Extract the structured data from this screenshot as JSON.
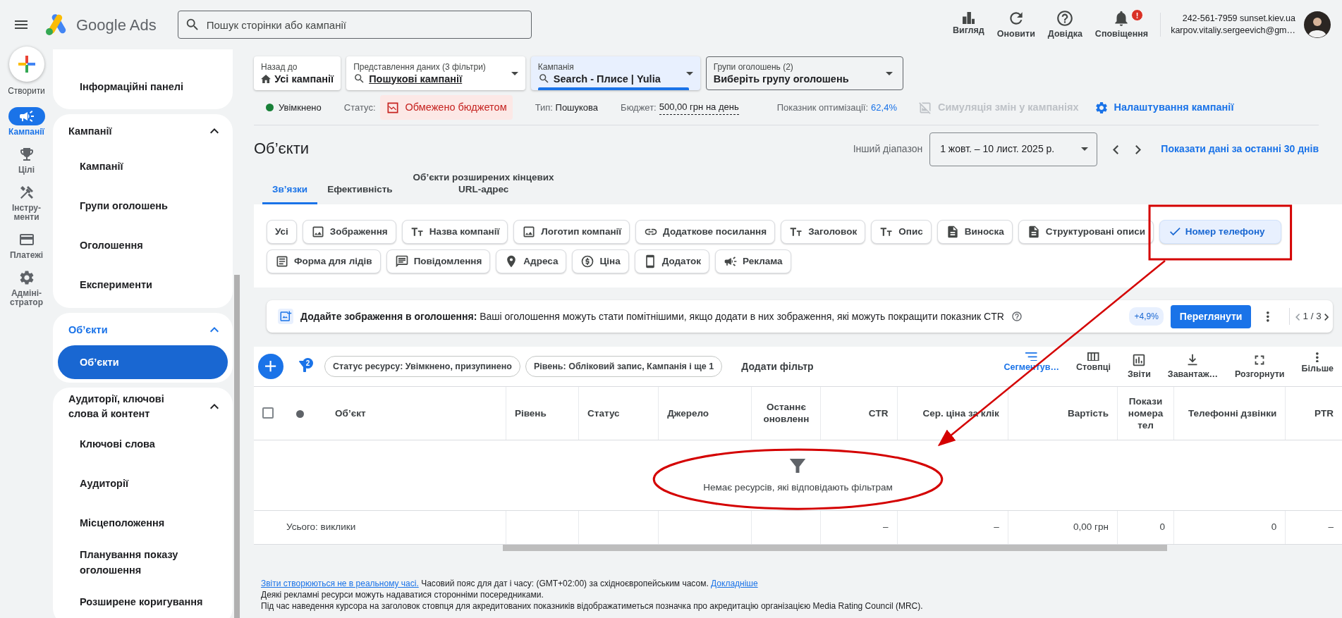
{
  "header": {
    "product": "Google Ads",
    "search": {
      "placeholder": "Пошук сторінки або кампанії"
    },
    "actions": [
      {
        "label": "Вигляд"
      },
      {
        "label": "Оновити"
      },
      {
        "label": "Довідка"
      },
      {
        "label": "Сповіщення",
        "alert": "!"
      }
    ],
    "account": {
      "line_1": "242-561-7959 sunset.kiev.ua",
      "line_2": "karpov.vitaliy.sergeevich@gm…"
    }
  },
  "rail": {
    "create": "Створити",
    "items": [
      {
        "label": "Кампанії",
        "selected": true
      },
      {
        "label": "Цілі",
        "selected": false
      },
      {
        "label": "Інстру-\nменти",
        "selected": false
      },
      {
        "label": "Платежі",
        "selected": false
      },
      {
        "label": "Адміні-\nстратор",
        "selected": false
      }
    ]
  },
  "sidebar": {
    "groups": [
      {
        "items": [
          {
            "label": "Інформаційні панелі",
            "selected": false
          }
        ]
      },
      {
        "title": "Кампанії",
        "expanded": true,
        "active": false,
        "items": [
          {
            "label": "Кампанії",
            "selected": false
          },
          {
            "label": "Групи оголошень",
            "selected": false
          },
          {
            "label": "Оголошення",
            "selected": false
          },
          {
            "label": "Експерименти",
            "selected": false
          }
        ]
      },
      {
        "title": "Об’єкти",
        "expanded": true,
        "active": true,
        "items": [
          {
            "label": "Об’єкти",
            "selected": true
          }
        ]
      },
      {
        "title": "Аудиторії, ключові слова й контент",
        "expanded": true,
        "active": false,
        "items": [
          {
            "label": "Ключові слова",
            "selected": false
          },
          {
            "label": "Аудиторії",
            "selected": false
          },
          {
            "label": "Місцеположення",
            "selected": false
          },
          {
            "label": "Планування показу оголошення",
            "selected": false
          },
          {
            "label": "Розширене коригування",
            "selected": false
          }
        ]
      }
    ]
  },
  "selectors": [
    {
      "kind": "card",
      "label": "Назад до",
      "value": "Усі кампанії",
      "selected": false
    },
    {
      "kind": "card",
      "label": "Представлення даних (3 фільтри)",
      "value": "Пошукові кампанії",
      "selected": false
    },
    {
      "kind": "card",
      "label": "Кампанія",
      "value": "Search - Плисе | Yulia",
      "selected": true
    },
    {
      "kind": "outlined",
      "label": "Групи оголошень (2)",
      "value": "Виберіть групу оголошень",
      "selected": false
    }
  ],
  "campaign_status": {
    "state": "Увімкнено",
    "on": true,
    "status_label": "Статус:",
    "status": "Обмежено бюджетом",
    "type_label": "Тип:",
    "type": "Пошукова",
    "budget_label": "Бюджет:",
    "budget": "500,00 грн на день",
    "score_label": "Показник оптимізації:",
    "score": "62,4%",
    "simulation": {
      "label": "Симуляція змін у кампаніях",
      "disabled": true
    },
    "settings": "Налаштування кампанії"
  },
  "page": {
    "title": "Об’єкти",
    "range_label": "Інший діапазон",
    "date_range": "1 жовт. – 10 лист. 2025 р.",
    "last_30_days": "Показати дані за останні 30 днів"
  },
  "tabs": [
    {
      "label": "Зв’язки",
      "selected": true
    },
    {
      "label": "Ефективність",
      "selected": false
    },
    {
      "label": "Об’єкти розширених кінцевих URL-адрес",
      "selected": false
    }
  ],
  "asset_types": [
    {
      "label": "Усі",
      "selected": false
    },
    {
      "label": "Зображення",
      "selected": false
    },
    {
      "label": "Назва компанії",
      "selected": false
    },
    {
      "label": "Логотип компанії",
      "selected": false
    },
    {
      "label": "Додаткове посилання",
      "selected": false
    },
    {
      "label": "Заголовок",
      "selected": false
    },
    {
      "label": "Опис",
      "selected": false
    },
    {
      "label": "Виноска",
      "selected": false
    },
    {
      "label": "Структуровані описи",
      "selected": false
    },
    {
      "label": "Номер телефону",
      "selected": true
    },
    {
      "label": "Форма для лідів",
      "selected": false
    },
    {
      "label": "Повідомлення",
      "selected": false
    },
    {
      "label": "Адреса",
      "selected": false
    },
    {
      "label": "Ціна",
      "selected": false
    },
    {
      "label": "Додаток",
      "selected": false
    },
    {
      "label": "Реклама",
      "selected": false
    }
  ],
  "recommendation": {
    "title": "Додайте зображення в оголошення:",
    "text": "Ваші оголошення можуть стати помітнішими, якщо додати в них зображення, які можуть покращити показник CTR",
    "uplift": "+4,9%",
    "button": "Переглянути",
    "pager": "1 / 3"
  },
  "table": {
    "filter_count": "2",
    "filters": [
      "Статус ресурсу: Увімкнено, призупинено",
      "Рівень: Обліковий запис, Кампанія і ще 1"
    ],
    "add_filter": "Додати фільтр",
    "tools": [
      {
        "label": "Сегментув…",
        "selected": true
      },
      {
        "label": "Стовпці",
        "selected": false
      },
      {
        "label": "Звіти",
        "selected": false
      },
      {
        "label": "Завантаж…",
        "selected": false
      },
      {
        "label": "Розгорнути",
        "selected": false
      },
      {
        "label": "Більше",
        "selected": false
      }
    ],
    "select_all": {
      "checked": false
    },
    "columns": [
      "Об’єкт",
      "Рівень",
      "Статус",
      "Джерело",
      "Останнє оновленн",
      "CTR",
      "Сер. ціна за клік",
      "Вартість",
      "Покази номера тел",
      "Телефонні дзвінки",
      "PTR"
    ],
    "empty_message": "Немає ресурсів, які відповідають фільтрам",
    "total_row": {
      "label": "Усього: виклики",
      "ctr": "–",
      "avg_cpc": "–",
      "cost": "0,00 грн",
      "phone_impressions": "0",
      "phone_calls": "0",
      "ptr": "–"
    }
  },
  "footer": {
    "link_1": "Звіти створюються не в реальному часі.",
    "timezone": "Часовий пояс для дат і часу: (GMT+02:00) за східноєвропейським часом.",
    "link_2": "Докладніше",
    "line_2": "Деякі рекламні ресурси можуть надаватися сторонніми посередниками.",
    "line_3": "Під час наведення курсора на заголовок стовпця для акредитованих показників відображатиметься позначка про акредитацію організацією Media Rating Council (MRC)."
  }
}
